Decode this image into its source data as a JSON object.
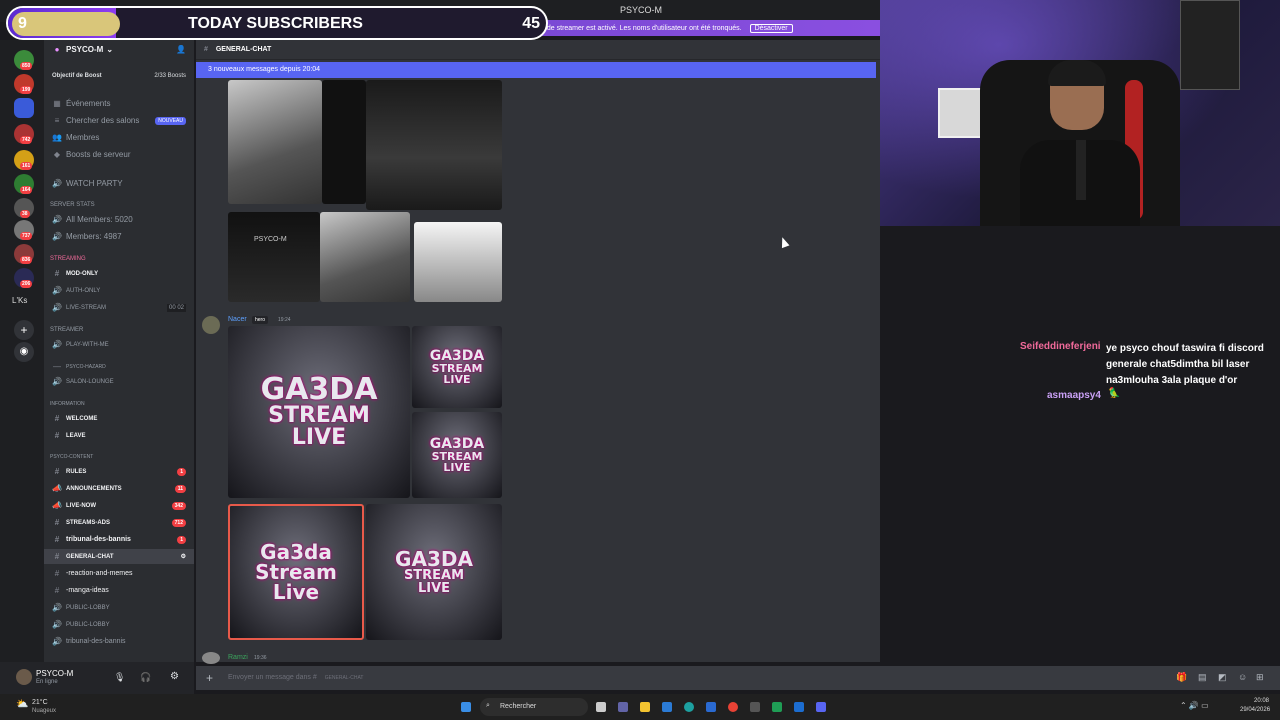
{
  "subscribers": {
    "count": "9",
    "label": "TODAY SUBSCRIBERS",
    "goal": "45",
    "progress": 0.2
  },
  "window": {
    "title": "PSYCO-M"
  },
  "streamer_banner": {
    "text": "…nde streamer est activé. Les noms d'utilisateur ont été tronqués.",
    "button": "Désactiver"
  },
  "rail": {
    "badges": [
      "850",
      "199",
      "742",
      "161",
      "164",
      "38",
      "737",
      "836",
      "206"
    ],
    "lks": "L'Ks"
  },
  "server": {
    "name": "PSYCO-M",
    "boost_goal": "Objectif de Boost",
    "boost_count": "2/33 Boosts"
  },
  "menu": [
    {
      "label": "Événements"
    },
    {
      "label": "Chercher des salons",
      "badge": "NOUVEAU"
    },
    {
      "label": "Membres"
    },
    {
      "label": "Boosts de serveur"
    }
  ],
  "channels": {
    "watch_party": "WATCH PARTY",
    "server_stats": "SERVER STATS",
    "all_members": "All Members: 5020",
    "members": "Members: 4987",
    "cat_streaming": "STREAMING",
    "mod_only": "MOD-ONLY",
    "auth_only": "AUTH-ONLY",
    "live_stream": "LIVE-STREAM",
    "live_stream_counts": "00  02",
    "cat_streamer": "STREAMER",
    "play_with_me": "PLAY-WITH-ME",
    "psyco_hazard": "PSYCO-HAZARD",
    "salon_lounge": "SALON-LOUNGE",
    "cat_information": "INFORMATION",
    "welcome": "WELCOME",
    "leave": "LEAVE",
    "cat_psyco_content": "PSYCO-CONTENT",
    "rules": "RULES",
    "rules_count": "1",
    "announcements": "ANNOUNCEMENTS",
    "announcements_count": "11",
    "live_now": "LIVE-NOW",
    "live_now_count": "342",
    "streams_ads": "STREAMS-ADS",
    "streams_ads_count": "712",
    "tribunal": "tribunal-des-bannis",
    "tribunal_count": "1",
    "general_chat": "GENERAL-CHAT",
    "reaction": "-reaction-and-memes",
    "manga": "-manga-ideas",
    "public_lobby_1": "PUBLIC-LOBBY",
    "public_lobby_2": "PUBLIC-LOBBY",
    "tribunal_voice": "tribunal-des-bannis"
  },
  "user": {
    "name": "PSYCO-M",
    "status": "En ligne"
  },
  "chat": {
    "channel": "GENERAL-CHAT",
    "new_messages": "3 nouveaux messages depuis 20:04",
    "msg1_author": "Nacer",
    "msg1_tag": "hero",
    "msg1_time": "19:24",
    "msg2_author": "Ramzi",
    "msg2_time": "19:36",
    "composer_placeholder": "Envoyer un message dans #",
    "composer_channel": "GENERAL-CHAT",
    "image_texts": [
      "GA3DA",
      "STREAM",
      "LIVE",
      "Ga3da",
      "Stream",
      "Live",
      "PSYCO-M"
    ]
  },
  "stream_chat": [
    {
      "user": "Seifeddineferjeni",
      "color": "#f06a9a",
      "text": "ye psyco chouf taswira fi discord generale chat5dimtha bil laser na3mlouha 3ala plaque d'or"
    },
    {
      "user": "asmaapsy4",
      "color": "#c9a0f5",
      "text": "🦜"
    }
  ],
  "taskbar": {
    "weather_temp": "21°C",
    "weather_text": "Nuageux",
    "search": "Rechercher",
    "time": "20:08",
    "date": "29/04/2026"
  }
}
